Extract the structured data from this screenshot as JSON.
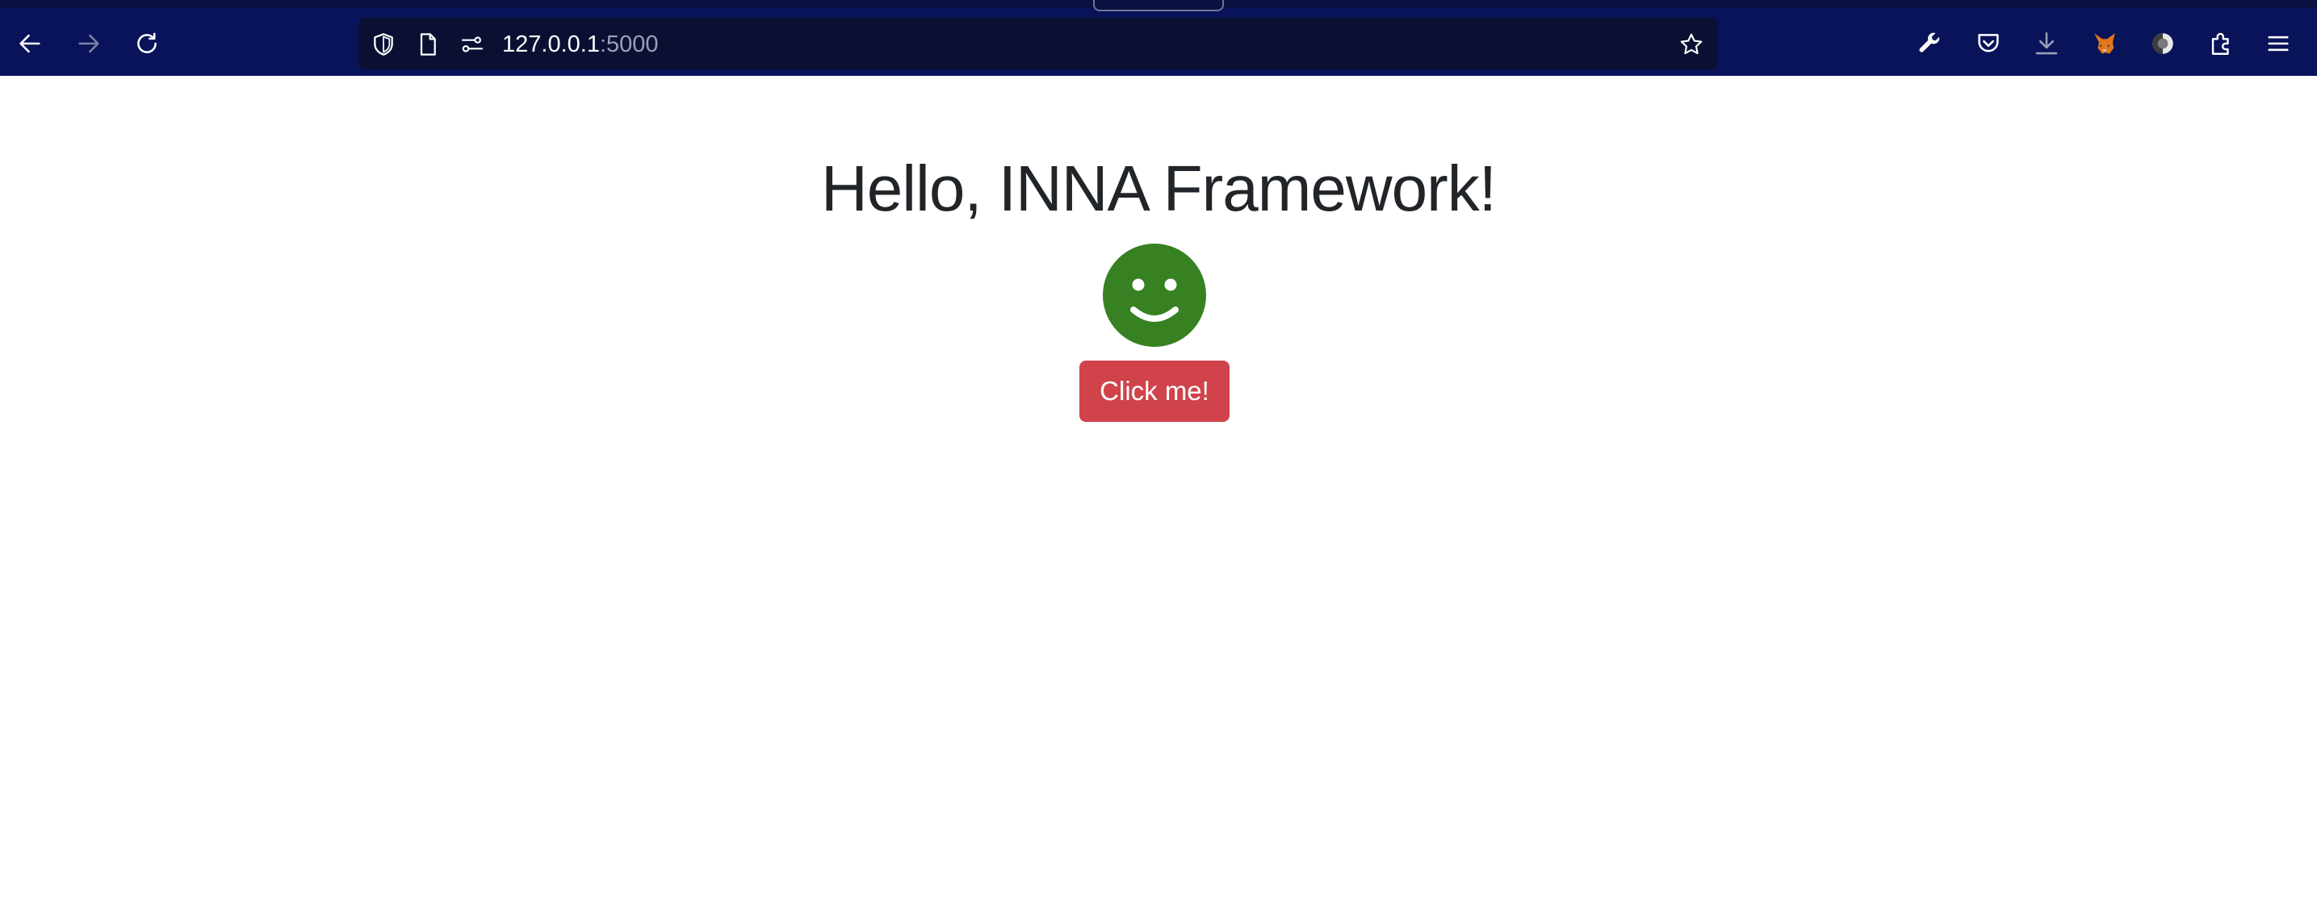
{
  "browser": {
    "url_host": "127.0.0.1",
    "url_port": ":5000",
    "nav": {
      "back_icon": "arrow-left-icon",
      "forward_icon": "arrow-right-icon",
      "reload_icon": "reload-icon"
    },
    "url_icons": [
      "shield-icon",
      "page-icon",
      "permissions-icon"
    ],
    "toolbar_icons": [
      "wrench-icon",
      "pocket-icon",
      "download-icon",
      "fox-extension-icon",
      "contrast-extension-icon",
      "extensions-icon",
      "menu-icon"
    ],
    "colors": {
      "toolbar": "#08135a",
      "urlbar": "#0b1033"
    }
  },
  "page": {
    "title": "Hello, INNA Framework!",
    "smiley_icon": "smiley-face-icon",
    "button_label": "Click me!",
    "colors": {
      "smiley": "#378122",
      "button": "#d0434a",
      "text": "#212529"
    }
  }
}
